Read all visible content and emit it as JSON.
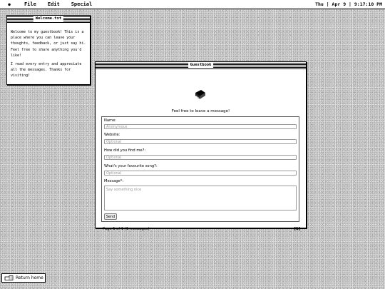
{
  "menubar": {
    "menus": [
      "File",
      "Edit",
      "Special"
    ],
    "clock": "Thu | Apr 9 | 9:17:10 PM"
  },
  "welcome": {
    "title": "Welcome.txt",
    "paragraph1": "Welcome to my guestbook! This is a place where you can leave your thoughts, feedback, or just say hi. Feel free to share anything you'd like!",
    "paragraph2": "I read every entry and appreciate all the messages. Thanks for visiting!"
  },
  "guestbook": {
    "title": "Guestbook",
    "tagline": "Feel free to leave a message!",
    "fields": {
      "name_label": "Name:",
      "name_placeholder": "Anonymous",
      "website_label": "Website:",
      "website_placeholder": "Optional",
      "found_label": "How did you find me?:",
      "found_placeholder": "Optional",
      "song_label": "What's your favourite song?:",
      "song_placeholder": "Optional",
      "message_label": "Message*:",
      "message_placeholder": "Say something nice"
    },
    "send_label": "Send",
    "pagination": "Page 1 of 1 (1 messages)",
    "page_link": "[1]"
  },
  "footer": {
    "return_label": "Return home"
  },
  "colors": {
    "window_bg": "#ffffff",
    "border": "#000000",
    "placeholder": "#999999"
  }
}
